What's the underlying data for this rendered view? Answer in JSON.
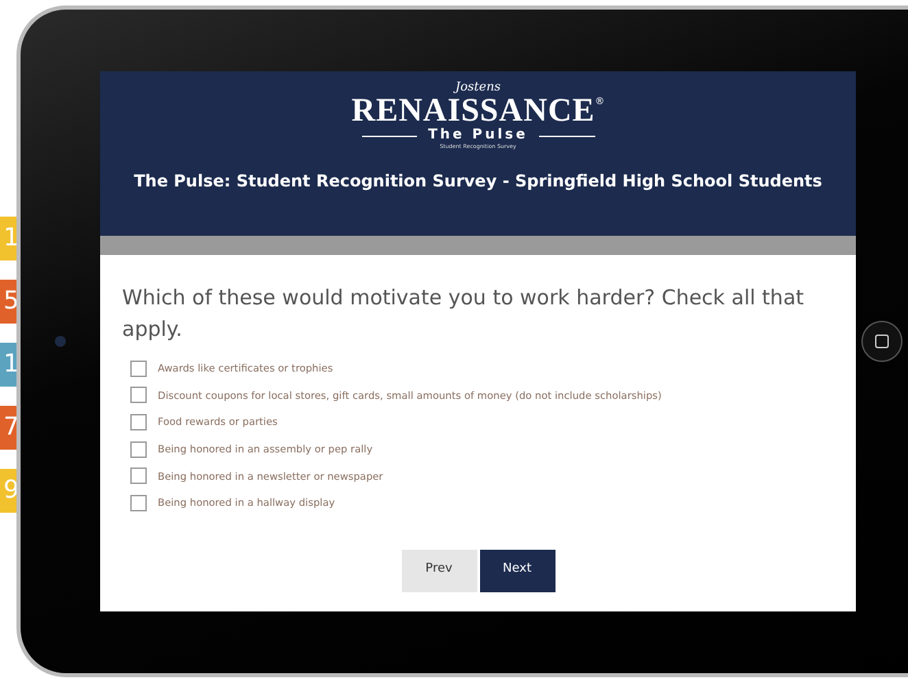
{
  "background_tiles": [
    {
      "text": "1",
      "color": "#f2c12e"
    },
    {
      "text": "5",
      "color": "#e0622a"
    },
    {
      "text": "1",
      "color": "#5ba3bf"
    },
    {
      "text": "7",
      "color": "#e0622a"
    },
    {
      "text": "9",
      "color": "#f2c12e"
    }
  ],
  "header": {
    "logo": {
      "brand": "Jostens",
      "wordmark": "RENAISSANCE",
      "registered": "®",
      "tagline": "The Pulse",
      "subtitle": "Student Recognition Survey"
    },
    "title": "The Pulse: Student Recognition Survey - Springfield High School Students"
  },
  "question": {
    "text": "Which of these would motivate you to work harder? Check all that apply.",
    "options": [
      {
        "label": "Awards like certificates or trophies",
        "checked": false
      },
      {
        "label": "Discount coupons for local stores, gift cards, small amounts of money (do not include scholarships)",
        "checked": false
      },
      {
        "label": "Food rewards or parties",
        "checked": false
      },
      {
        "label": "Being honored in an assembly or pep rally",
        "checked": false
      },
      {
        "label": "Being honored in a newsletter or newspaper",
        "checked": false
      },
      {
        "label": "Being honored in a hallway display",
        "checked": false
      }
    ]
  },
  "buttons": [
    {
      "label": "Prev",
      "kind": "secondary"
    },
    {
      "label": "Next",
      "kind": "primary"
    }
  ]
}
